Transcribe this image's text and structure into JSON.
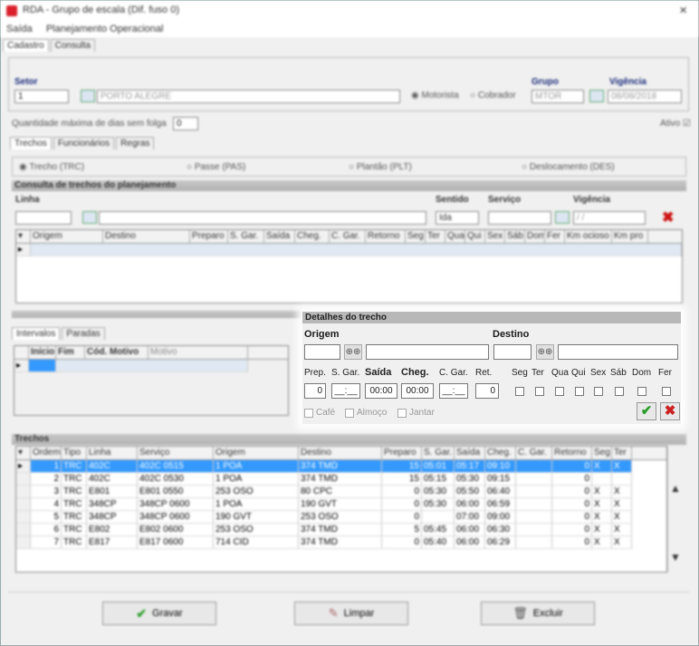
{
  "window": {
    "title": "RDA - Grupo de escala (Dif. fuso 0)",
    "close": "×"
  },
  "menu": [
    "Saída",
    "Planejamento Operacional"
  ],
  "tabs_top": [
    "Cadastro",
    "Consulta"
  ],
  "setor": {
    "label": "Setor",
    "code": "1",
    "name": "PORTO ALEGRE"
  },
  "motorista": "Motorista",
  "cobrador": "Cobrador",
  "grupo": {
    "label": "Grupo",
    "value": "MTOR"
  },
  "vigencia": {
    "label": "Vigência",
    "value": "08/08/2018"
  },
  "qtd_label": "Quantidade máxima de dias sem folga",
  "qtd_value": "0",
  "ativo_label": "Ativo",
  "tabs_mid": [
    "Trechos",
    "Funcionários",
    "Regras"
  ],
  "radios": [
    "Trecho (TRC)",
    "Passe (PAS)",
    "Plantão (PLT)",
    "Deslocamento (DES)"
  ],
  "consulta_title": "Consulta de trechos do planejamento",
  "linha_label": "Linha",
  "sentido_label": "Sentido",
  "sentido_value": "Ida",
  "servico_label": "Serviço",
  "vigencia2_label": "Vigência",
  "vigencia2_value": "/ /",
  "consulta_cols": [
    "Origem",
    "Destino",
    "Preparo",
    "S. Gar.",
    "Saída",
    "Cheg.",
    "C. Gar.",
    "Retorno",
    "Seg",
    "Ter",
    "Qua",
    "Qui",
    "Sex",
    "Sáb",
    "Dom",
    "Fer",
    "Km ocioso",
    "Km pro"
  ],
  "tabs_low": [
    "Intervalos",
    "Paradas"
  ],
  "intervalos_cols": [
    "Início",
    "Fim",
    "Cód. Motivo",
    "Motivo"
  ],
  "detalhes": {
    "title": "Detalhes do trecho",
    "origem_label": "Origem",
    "destino_label": "Destino",
    "prep_label": "Prep.",
    "sgar_label": "S. Gar.",
    "saida_label": "Saída",
    "cheg_label": "Cheg.",
    "cgar_label": "C. Gar.",
    "ret_label": "Ret.",
    "days": [
      "Seg",
      "Ter",
      "Qua",
      "Qui",
      "Sex",
      "Sáb",
      "Dom",
      "Fer"
    ],
    "prep_value": "0",
    "sgar_value": "__:__",
    "saida_value": "00:00",
    "cheg_value": "00:00",
    "cgar_value": "__:__",
    "ret_value": "0",
    "cafe": "Café",
    "almoco": "Almoço",
    "jantar": "Jantar",
    "ok": "✔",
    "cancel": "✖"
  },
  "trechos_title": "Trechos",
  "trechos_cols": [
    "Ordem",
    "Tipo",
    "Linha",
    "Serviço",
    "Origem",
    "Destino",
    "Preparo",
    "S. Gar.",
    "Saída",
    "Cheg.",
    "C. Gar.",
    "Retorno",
    "Seg",
    "Ter"
  ],
  "trechos_rows": [
    [
      "1",
      "TRC",
      "402C",
      "402C 0515",
      "1 POA",
      "374 TMD",
      "15",
      "05:01",
      "05:17",
      "09:10",
      "",
      "0",
      "X",
      "X"
    ],
    [
      "2",
      "TRC",
      "402C",
      "402C 0530",
      "1 POA",
      "374 TMD",
      "15",
      "05:15",
      "05:30",
      "09:15",
      "",
      "0",
      "",
      ""
    ],
    [
      "3",
      "TRC",
      "E801",
      "E801 0550",
      "253 OSO",
      "80 CPC",
      "0",
      "05:30",
      "05:50",
      "06:40",
      "",
      "0",
      "X",
      "X"
    ],
    [
      "4",
      "TRC",
      "348CP",
      "348CP 0600",
      "1 POA",
      "190 GVT",
      "0",
      "05:30",
      "06:00",
      "06:59",
      "",
      "0",
      "X",
      "X"
    ],
    [
      "5",
      "TRC",
      "348CP",
      "348CP 0600",
      "190 GVT",
      "253 OSO",
      "0",
      "",
      "07:00",
      "09:00",
      "",
      "0",
      "X",
      "X"
    ],
    [
      "6",
      "TRC",
      "E802",
      "E802 0600",
      "253 OSO",
      "374 TMD",
      "5",
      "05:45",
      "06:00",
      "06:30",
      "",
      "0",
      "X",
      "X"
    ],
    [
      "7",
      "TRC",
      "E817",
      "E817 0600",
      "714 CID",
      "374 TMD",
      "0",
      "05:40",
      "06:00",
      "06:29",
      "",
      "0",
      "X",
      "X"
    ]
  ],
  "buttons": {
    "gravar": "Gravar",
    "limpar": "Limpar",
    "excluir": "Excluir"
  },
  "colors": {
    "selection": "#3399ff",
    "ok_green": "#2a9d2a",
    "cancel_red": "#cc1f1f",
    "header_blue": "#1a2b7a"
  }
}
